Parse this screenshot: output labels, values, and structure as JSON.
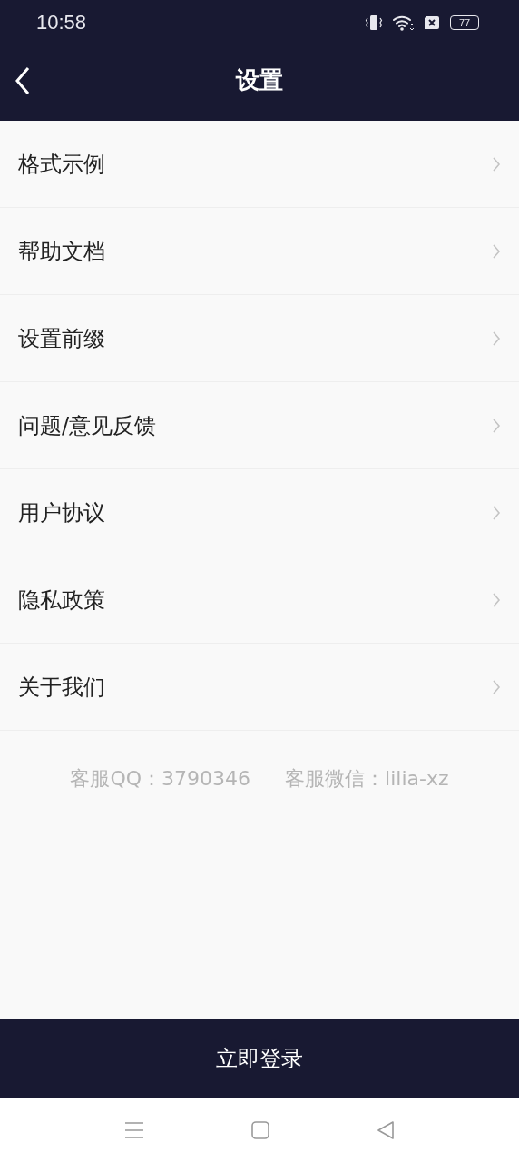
{
  "status_bar": {
    "time": "10:58",
    "battery": "77"
  },
  "header": {
    "title": "设置"
  },
  "menu": {
    "items": [
      {
        "label": "格式示例"
      },
      {
        "label": "帮助文档"
      },
      {
        "label": "设置前缀"
      },
      {
        "label": "问题/意见反馈"
      },
      {
        "label": "用户协议"
      },
      {
        "label": "隐私政策"
      },
      {
        "label": "关于我们"
      }
    ]
  },
  "contact": [
    "客服QQ：3790346",
    "客服微信：lilia-xz"
  ],
  "login_button": "立即登录"
}
